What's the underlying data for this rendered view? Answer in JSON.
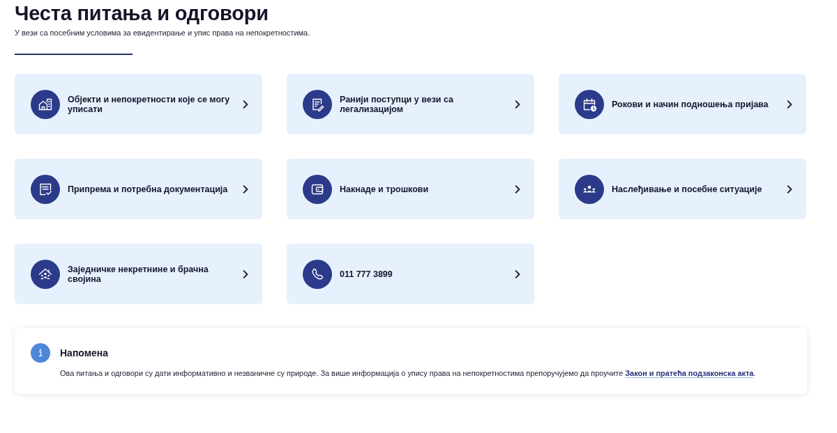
{
  "header": {
    "title": "Честа питања и одговори",
    "subtitle": "У вези са посебним условима за евидентирање и упис права на непокретностима."
  },
  "cards": [
    {
      "label": "Објекти и непокретности које се могу уписати"
    },
    {
      "label": "Ранији поступци у вези са легализацијом"
    },
    {
      "label": "Рокови и начин подношења пријава"
    },
    {
      "label": "Припрема и потребна документација"
    },
    {
      "label": "Накнаде и трошкови"
    },
    {
      "label": "Наслеђивање и посебне ситуације"
    },
    {
      "label": "Заједничке некретнине и брачна својина"
    },
    {
      "label": "011 777 3899"
    }
  ],
  "note": {
    "title": "Напомена",
    "text": "Ова питања и одговори су дати информативно и незваничне су природе. За више информација о упису права на непокретностима препоручујемо да проучите",
    "link": "Закон и пратећа подзаконска акта",
    "text_end": "."
  }
}
